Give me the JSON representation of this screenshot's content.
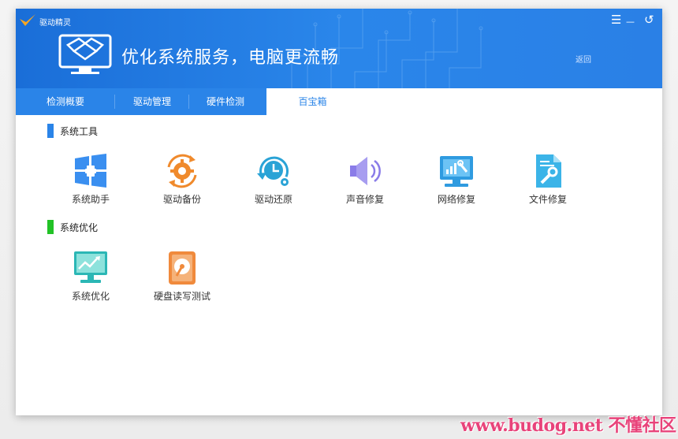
{
  "app": {
    "name": "驱动精灵",
    "headline": "优化系统服务，电脑更流畅",
    "back_label": "返回"
  },
  "window_controls": {
    "menu": "☰",
    "minimize": "—",
    "back": "↺"
  },
  "tabs": [
    {
      "label": "检测概要"
    },
    {
      "label": "驱动管理"
    },
    {
      "label": "硬件检测"
    },
    {
      "label": "百宝箱",
      "active": true
    }
  ],
  "sections": {
    "tools": {
      "title": "系统工具",
      "accent": "#2a84e8",
      "items": [
        {
          "label": "系统助手",
          "icon": "windows-plus-icon"
        },
        {
          "label": "驱动备份",
          "icon": "gear-backup-icon"
        },
        {
          "label": "驱动还原",
          "icon": "clock-restore-icon"
        },
        {
          "label": "声音修复",
          "icon": "speaker-icon"
        },
        {
          "label": "网络修复",
          "icon": "network-monitor-icon"
        },
        {
          "label": "文件修复",
          "icon": "file-repair-icon"
        }
      ]
    },
    "optimize": {
      "title": "系统优化",
      "accent": "#22c226",
      "items": [
        {
          "label": "系统优化",
          "icon": "monitor-chart-icon"
        },
        {
          "label": "硬盘读写测试",
          "icon": "hard-disk-icon"
        }
      ]
    }
  },
  "watermark": "www.budog.net 不懂社区"
}
